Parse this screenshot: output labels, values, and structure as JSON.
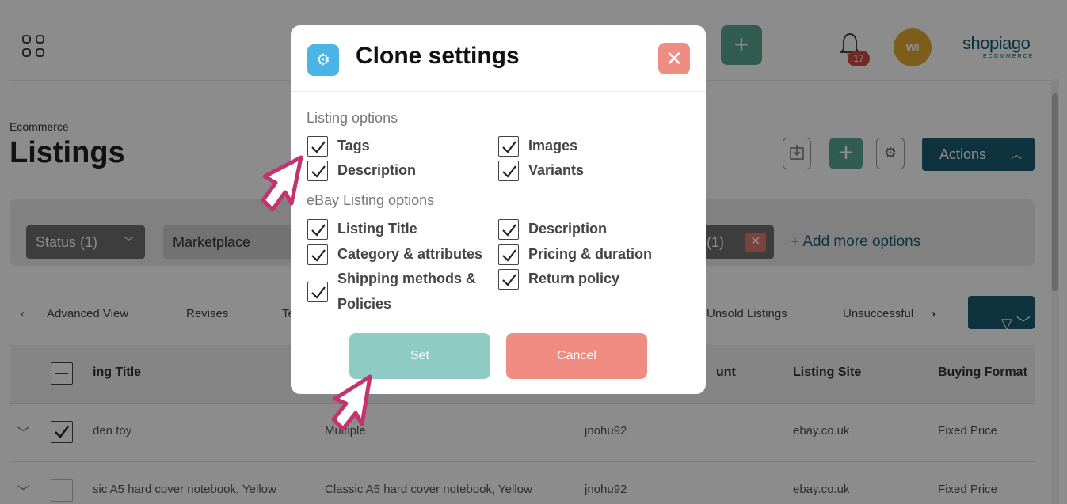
{
  "header": {
    "notification_count": "17",
    "avatar_initials": "WI",
    "logo_text": "shopiago",
    "logo_subtext": "ECOMMERCE"
  },
  "page": {
    "breadcrumb": "Ecommerce",
    "title": "Listings",
    "actions_label": "Actions"
  },
  "filters": {
    "status_label": "Status (1)",
    "marketplace_label": "Marketplace",
    "active_chip_label": "(1)",
    "add_more_label": "+ Add more options"
  },
  "tabs": {
    "items": [
      "Advanced View",
      "Revises",
      "Te",
      "Unsold Listings",
      "Unsuccessful"
    ]
  },
  "table": {
    "columns": [
      "ing Title",
      "unt",
      "Listing Site",
      "Buying Format"
    ],
    "rows": [
      {
        "title": "den toy",
        "variation": "Multiple",
        "account": "jnohu92",
        "site": "ebay.co.uk",
        "format": "Fixed Price",
        "checked": true
      },
      {
        "title": "sic A5 hard cover notebook, Yellow",
        "variation": "Classic A5 hard cover notebook, Yellow",
        "account": "jnohu92",
        "site": "ebay.co.uk",
        "format": "Fixed Price",
        "checked": false
      }
    ]
  },
  "modal": {
    "title": "Clone settings",
    "listing_options_label": "Listing options",
    "listing_options": {
      "tags": "Tags",
      "images": "Images",
      "description": "Description",
      "variants": "Variants"
    },
    "ebay_options_label": "eBay Listing options",
    "ebay_options": {
      "listing_title": "Listing Title",
      "description": "Description",
      "category": "Category & attributes",
      "pricing": "Pricing & duration",
      "shipping_line1": "Shipping methods &",
      "shipping_line2": "Policies",
      "return_policy": "Return policy"
    },
    "set_label": "Set",
    "cancel_label": "Cancel"
  },
  "colors": {
    "accent_teal": "#1d5d72",
    "green": "#5aa896",
    "close_red": "#f08d83",
    "set_button": "#8dcbc3",
    "pointer_pink": "#c4336e"
  }
}
